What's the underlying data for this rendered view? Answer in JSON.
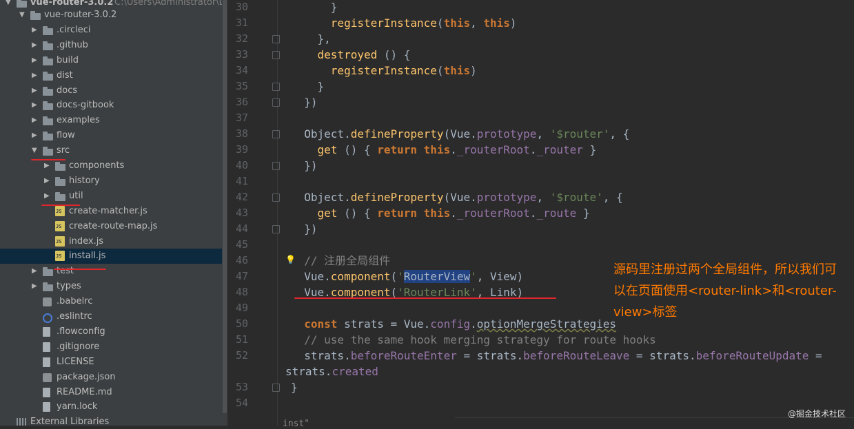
{
  "project": {
    "root_name": "vue-router-3.0.2",
    "root_path": "C:\\Users\\Administrator\\Down",
    "tree": [
      {
        "label": "vue-router-3.0.2",
        "kind": "folder",
        "depth": 1,
        "arrow": "down"
      },
      {
        "label": ".circleci",
        "kind": "folder",
        "depth": 2,
        "arrow": "right"
      },
      {
        "label": ".github",
        "kind": "folder",
        "depth": 2,
        "arrow": "right"
      },
      {
        "label": "build",
        "kind": "folder",
        "depth": 2,
        "arrow": "right"
      },
      {
        "label": "dist",
        "kind": "folder",
        "depth": 2,
        "arrow": "right"
      },
      {
        "label": "docs",
        "kind": "folder",
        "depth": 2,
        "arrow": "right"
      },
      {
        "label": "docs-gitbook",
        "kind": "folder",
        "depth": 2,
        "arrow": "right"
      },
      {
        "label": "examples",
        "kind": "folder",
        "depth": 2,
        "arrow": "right"
      },
      {
        "label": "flow",
        "kind": "folder",
        "depth": 2,
        "arrow": "right"
      },
      {
        "label": "src",
        "kind": "folder",
        "depth": 2,
        "arrow": "down"
      },
      {
        "label": "components",
        "kind": "folder",
        "depth": 3,
        "arrow": "right"
      },
      {
        "label": "history",
        "kind": "folder",
        "depth": 3,
        "arrow": "right"
      },
      {
        "label": "util",
        "kind": "folder",
        "depth": 3,
        "arrow": "right"
      },
      {
        "label": "create-matcher.js",
        "kind": "js",
        "depth": 3,
        "arrow": ""
      },
      {
        "label": "create-route-map.js",
        "kind": "js",
        "depth": 3,
        "arrow": ""
      },
      {
        "label": "index.js",
        "kind": "js",
        "depth": 3,
        "arrow": ""
      },
      {
        "label": "install.js",
        "kind": "js",
        "depth": 3,
        "arrow": "",
        "selected": true
      },
      {
        "label": "test",
        "kind": "folder",
        "depth": 2,
        "arrow": "right"
      },
      {
        "label": "types",
        "kind": "folder",
        "depth": 2,
        "arrow": "right"
      },
      {
        "label": ".babelrc",
        "kind": "cfg",
        "depth": 2,
        "arrow": ""
      },
      {
        "label": ".eslintrc",
        "kind": "ring",
        "depth": 2,
        "arrow": ""
      },
      {
        "label": ".flowconfig",
        "kind": "file",
        "depth": 2,
        "arrow": ""
      },
      {
        "label": ".gitignore",
        "kind": "file",
        "depth": 2,
        "arrow": ""
      },
      {
        "label": "LICENSE",
        "kind": "file",
        "depth": 2,
        "arrow": ""
      },
      {
        "label": "package.json",
        "kind": "cfg",
        "depth": 2,
        "arrow": ""
      },
      {
        "label": "README.md",
        "kind": "file",
        "depth": 2,
        "arrow": ""
      },
      {
        "label": "yarn.lock",
        "kind": "file",
        "depth": 2,
        "arrow": ""
      },
      {
        "label": "External Libraries",
        "kind": "lib",
        "depth": 0,
        "arrow": ""
      }
    ]
  },
  "editor": {
    "lines": [
      {
        "n": "30",
        "parts": [
          [
            "t",
            "      }"
          ]
        ]
      },
      {
        "n": "31",
        "parts": [
          [
            "t",
            "      "
          ],
          [
            "fn",
            "registerInstance"
          ],
          [
            "t",
            "("
          ],
          [
            "kw",
            "this"
          ],
          [
            "t",
            ", "
          ],
          [
            "kw",
            "this"
          ],
          [
            "t",
            ")"
          ]
        ]
      },
      {
        "n": "32",
        "parts": [
          [
            "t",
            "    },"
          ]
        ]
      },
      {
        "n": "33",
        "parts": [
          [
            "t",
            "    "
          ],
          [
            "fn",
            "destroyed"
          ],
          [
            "t",
            " () {"
          ]
        ]
      },
      {
        "n": "34",
        "parts": [
          [
            "t",
            "      "
          ],
          [
            "fn",
            "registerInstance"
          ],
          [
            "t",
            "("
          ],
          [
            "kw",
            "this"
          ],
          [
            "t",
            ")"
          ]
        ]
      },
      {
        "n": "35",
        "parts": [
          [
            "t",
            "    }"
          ]
        ]
      },
      {
        "n": "36",
        "parts": [
          [
            "t",
            "  })"
          ]
        ]
      },
      {
        "n": "37",
        "parts": []
      },
      {
        "n": "38",
        "parts": [
          [
            "t",
            "  Object."
          ],
          [
            "fn",
            "defineProperty"
          ],
          [
            "t",
            "(Vue."
          ],
          [
            "prop",
            "prototype"
          ],
          [
            "t",
            ", "
          ],
          [
            "str",
            "'$router'"
          ],
          [
            "t",
            ", {"
          ]
        ]
      },
      {
        "n": "39",
        "parts": [
          [
            "t",
            "    "
          ],
          [
            "fn",
            "get"
          ],
          [
            "t",
            " () { "
          ],
          [
            "kw",
            "return"
          ],
          [
            "t",
            " "
          ],
          [
            "kw",
            "this"
          ],
          [
            "t",
            "."
          ],
          [
            "prop",
            "_routerRoot"
          ],
          [
            "t",
            "."
          ],
          [
            "prop",
            "_router"
          ],
          [
            "t",
            " }"
          ]
        ]
      },
      {
        "n": "40",
        "parts": [
          [
            "t",
            "  })"
          ]
        ]
      },
      {
        "n": "41",
        "parts": []
      },
      {
        "n": "42",
        "parts": [
          [
            "t",
            "  Object."
          ],
          [
            "fn",
            "defineProperty"
          ],
          [
            "t",
            "(Vue."
          ],
          [
            "prop",
            "prototype"
          ],
          [
            "t",
            ", "
          ],
          [
            "str",
            "'$route'"
          ],
          [
            "t",
            ", {"
          ]
        ]
      },
      {
        "n": "43",
        "parts": [
          [
            "t",
            "    "
          ],
          [
            "fn",
            "get"
          ],
          [
            "t",
            " () { "
          ],
          [
            "kw",
            "return"
          ],
          [
            "t",
            " "
          ],
          [
            "kw",
            "this"
          ],
          [
            "t",
            "."
          ],
          [
            "prop",
            "_routerRoot"
          ],
          [
            "t",
            "."
          ],
          [
            "prop",
            "_route"
          ],
          [
            "t",
            " }"
          ]
        ]
      },
      {
        "n": "44",
        "parts": [
          [
            "t",
            "  })"
          ]
        ]
      },
      {
        "n": "45",
        "parts": []
      },
      {
        "n": "46",
        "parts": [
          [
            "cmt",
            "  // 注册全局组件"
          ]
        ]
      },
      {
        "n": "47",
        "parts": [
          [
            "t",
            "  Vue."
          ],
          [
            "fn",
            "component"
          ],
          [
            "t",
            "("
          ],
          [
            "str",
            "'"
          ],
          [
            "hl",
            "RouterView"
          ],
          [
            "str",
            "'"
          ],
          [
            "t",
            ", View)"
          ]
        ]
      },
      {
        "n": "48",
        "parts": [
          [
            "t",
            "  Vue."
          ],
          [
            "fn",
            "component"
          ],
          [
            "t",
            "("
          ],
          [
            "str",
            "'RouterLink'"
          ],
          [
            "t",
            ", Link)"
          ]
        ]
      },
      {
        "n": "49",
        "parts": []
      },
      {
        "n": "50",
        "parts": [
          [
            "t",
            "  "
          ],
          [
            "kw",
            "const"
          ],
          [
            "t",
            " strats = Vue."
          ],
          [
            "prop",
            "config"
          ],
          [
            "t",
            "."
          ],
          [
            "wavy",
            "optionMergeStrategies"
          ]
        ]
      },
      {
        "n": "51",
        "parts": [
          [
            "cmt",
            "  // use the same hook merging strategy for route hooks"
          ]
        ]
      },
      {
        "n": "52",
        "parts": [
          [
            "t",
            "  strats."
          ],
          [
            "prop",
            "beforeRouteEnter"
          ],
          [
            "t",
            " = strats."
          ],
          [
            "prop",
            "beforeRouteLeave"
          ],
          [
            "t",
            " = strats."
          ],
          [
            "prop",
            "beforeRouteUpdate"
          ],
          [
            "t",
            " ="
          ]
        ]
      },
      {
        "n": "",
        "parts": [
          [
            "t",
            "strats."
          ],
          [
            "prop",
            "created"
          ]
        ]
      },
      {
        "n": "53",
        "parts": [
          [
            "t",
            "}"
          ]
        ]
      },
      {
        "n": "54",
        "parts": []
      }
    ]
  },
  "annotation": "源码里注册过两个全局组件，所以我们可以在页面使用<router-link>和<router-view>标签",
  "watermark": "@掘金技术社区",
  "bottom_hint": "inst\""
}
